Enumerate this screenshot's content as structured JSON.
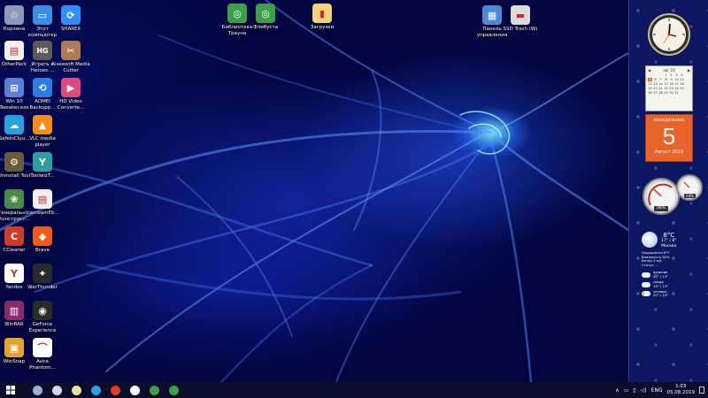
{
  "desktop": {
    "icons": [
      {
        "label": "Корзина",
        "icon": "recycle-bin-icon",
        "color": "#8a9bb8",
        "glyph": "♲"
      },
      {
        "label": "Этот компьютер",
        "icon": "this-pc-icon",
        "color": "#3a8ee6",
        "glyph": "▭"
      },
      {
        "label": "SHAREit",
        "icon": "shareit-icon",
        "color": "#2f8fff",
        "glyph": "⟳"
      },
      {
        "label": "OtherPack",
        "icon": "folder-icon",
        "color": "#f2f2f2",
        "glyph": "▤"
      },
      {
        "label": "Играть в Heroes ...",
        "icon": "heroes-game-icon",
        "color": "#5a5a5a",
        "glyph": "HG"
      },
      {
        "label": "Aiseesoft Media Cutter",
        "icon": "media-cutter-icon",
        "color": "#b07a52",
        "glyph": "✂"
      },
      {
        "label": "Win 10 Tweaker.exe",
        "icon": "windows-tweaker-icon",
        "color": "#5a7fd6",
        "glyph": "⊞"
      },
      {
        "label": "AOMEI Backupp...",
        "icon": "aomei-backup-icon",
        "color": "#2d7de0",
        "glyph": "⟲"
      },
      {
        "label": "HD Video Converte...",
        "icon": "video-converter-icon",
        "color": "#e04a7a",
        "glyph": "▶"
      },
      {
        "label": "SafeInClou...",
        "icon": "safeincloud-icon",
        "color": "#2a9fe0",
        "glyph": "☁"
      },
      {
        "label": "VLC media player",
        "icon": "vlc-icon",
        "color": "#f28a1c",
        "glyph": "▲"
      },
      {
        "label": "Uninstall Tool",
        "icon": "uninstall-tool-icon",
        "color": "#6b5a3a",
        "glyph": "⚙"
      },
      {
        "label": "ToolwizT...",
        "icon": "toolwiz-icon",
        "color": "#2aa0a0",
        "glyph": "Y"
      },
      {
        "label": "Генеральн... Конструкт...",
        "icon": "constructor-icon",
        "color": "#4a8a4a",
        "glyph": "❀"
      },
      {
        "label": "IcecreamEb...",
        "icon": "icecream-ebook-icon",
        "color": "#f0f0f0",
        "glyph": "▤"
      },
      {
        "label": "CCleaner",
        "icon": "ccleaner-icon",
        "color": "#d03a2a",
        "glyph": "C"
      },
      {
        "label": "Brave",
        "icon": "brave-icon",
        "color": "#f25a1c",
        "glyph": "◆"
      },
      {
        "label": "Yandex",
        "icon": "yandex-icon",
        "color": "#ffffff",
        "glyph": "Y"
      },
      {
        "label": "WarThunder",
        "icon": "warthunder-icon",
        "color": "#2a2a2a",
        "glyph": "✦"
      },
      {
        "label": "WinRAR",
        "icon": "winrar-icon",
        "color": "#8a2a6a",
        "glyph": "▥"
      },
      {
        "label": "GeForce Experience",
        "icon": "geforce-icon",
        "color": "#2a2a2a",
        "glyph": "◉"
      },
      {
        "label": "WinSnap",
        "icon": "winsnap-icon",
        "color": "#e8a030",
        "glyph": "▣"
      },
      {
        "label": "Avira Phantom...",
        "icon": "avira-phantom-icon",
        "color": "#ffffff",
        "glyph": "⌒"
      },
      {
        "label": "Библиотека Трауна",
        "icon": "library-green-icon",
        "color": "#3aa04a",
        "glyph": "◎"
      },
      {
        "label": "Флибуста",
        "icon": "flibusta-icon",
        "color": "#3aa04a",
        "glyph": "◎"
      },
      {
        "label": "Загрузки",
        "icon": "downloads-folder-icon",
        "color": "#f2d27a",
        "glyph": "▮"
      },
      {
        "label": "Панель управления",
        "icon": "control-panel-icon",
        "color": "#4a8ad6",
        "glyph": "▦"
      },
      {
        "label": "SSD Trash (W)",
        "icon": "ssd-drive-icon",
        "color": "#dcdcdc",
        "glyph": "▬"
      }
    ]
  },
  "gadgets": {
    "calendar": {
      "month_label": "авг 19",
      "days": [
        "1",
        "2",
        "3",
        "4",
        "5",
        "6",
        "7",
        "8",
        "9",
        "10",
        "11",
        "12",
        "13",
        "14",
        "15",
        "16",
        "17",
        "18",
        "19",
        "20",
        "21",
        "22",
        "23",
        "24",
        "25",
        "26",
        "27",
        "28",
        "29",
        "30",
        "31"
      ],
      "today_weekday": "понедельник",
      "today_number": "5",
      "today_month_year": "Август 2019",
      "accent": "#e8642a"
    },
    "cpu_meter": {
      "cpu": "08%",
      "ram": "28%"
    },
    "weather": {
      "temperature": "8°C",
      "range": "17° / 8°",
      "city": "Москва",
      "details": [
        "Ощущается 8°C",
        "Влажность 82%",
        "Ветер 2 м/с",
        "Статус ..."
      ],
      "forecast": [
        {
          "day": "вторник",
          "temp": "20° / 13°"
        },
        {
          "day": "среда",
          "temp": "19° / 13°"
        },
        {
          "day": "четверг",
          "temp": "20° / 14°"
        }
      ]
    }
  },
  "taskbar": {
    "apps": [
      {
        "name": "start-button",
        "color": "#ffffff"
      },
      {
        "name": "task-view-icon",
        "color": "#9ab0d6"
      },
      {
        "name": "notepad-icon",
        "color": "#cfd8e8"
      },
      {
        "name": "file-manager-icon",
        "color": "#e8e0a0"
      },
      {
        "name": "browser-icon",
        "color": "#2a9fe0"
      },
      {
        "name": "yandex-browser-icon",
        "color": "#e03a2a"
      },
      {
        "name": "yandex-icon",
        "color": "#ffffff"
      },
      {
        "name": "utorrent-icon",
        "color": "#3aa04a"
      },
      {
        "name": "library-icon",
        "color": "#3aa04a"
      }
    ],
    "tray": {
      "language": "ENG",
      "time": "1:03",
      "date": "05.08.2019"
    }
  }
}
